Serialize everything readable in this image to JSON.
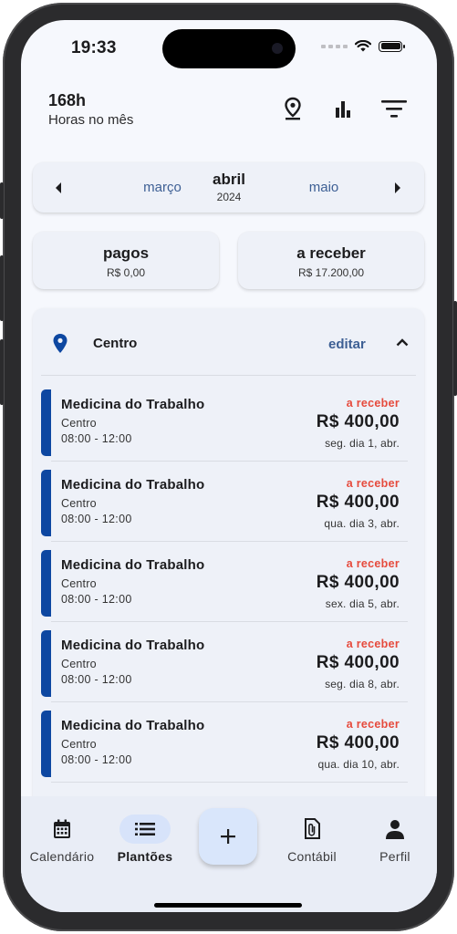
{
  "status_bar": {
    "time": "19:33"
  },
  "header": {
    "hours_value": "168h",
    "hours_label": "Horas no mês",
    "icons": [
      "location-icon",
      "bar-chart-icon",
      "filter-icon"
    ]
  },
  "month_selector": {
    "prev": "março",
    "current": "abril",
    "year": "2024",
    "next": "maio"
  },
  "summary": {
    "paid_title": "pagos",
    "paid_value": "R$ 0,00",
    "receivable_title": "a receber",
    "receivable_value": "R$ 17.200,00"
  },
  "location_group": {
    "name": "Centro",
    "edit_label": "editar",
    "shifts": [
      {
        "title": "Medicina do Trabalho",
        "location": "Centro",
        "time": "08:00 - 12:00",
        "status": "a receber",
        "amount": "R$ 400,00",
        "date": "seg. dia 1, abr."
      },
      {
        "title": "Medicina do Trabalho",
        "location": "Centro",
        "time": "08:00 - 12:00",
        "status": "a receber",
        "amount": "R$ 400,00",
        "date": "qua. dia 3, abr."
      },
      {
        "title": "Medicina do Trabalho",
        "location": "Centro",
        "time": "08:00 - 12:00",
        "status": "a receber",
        "amount": "R$ 400,00",
        "date": "sex. dia 5, abr."
      },
      {
        "title": "Medicina do Trabalho",
        "location": "Centro",
        "time": "08:00 - 12:00",
        "status": "a receber",
        "amount": "R$ 400,00",
        "date": "seg. dia 8, abr."
      },
      {
        "title": "Medicina do Trabalho",
        "location": "Centro",
        "time": "08:00 - 12:00",
        "status": "a receber",
        "amount": "R$ 400,00",
        "date": "qua. dia 10, abr."
      }
    ]
  },
  "bottom_nav": {
    "items": [
      {
        "label": "Calendário",
        "icon": "calendar-icon"
      },
      {
        "label": "Plantões",
        "icon": "list-icon"
      },
      {
        "label": "Contábil",
        "icon": "document-icon"
      },
      {
        "label": "Perfil",
        "icon": "person-icon"
      }
    ],
    "active": "Plantões",
    "fab_icon": "plus-icon"
  },
  "colors": {
    "accent": "#0d47a1",
    "link": "#3d5f94",
    "status_receivable": "#e64a3c",
    "background": "#f6f8fd",
    "card": "#eef1f8"
  }
}
